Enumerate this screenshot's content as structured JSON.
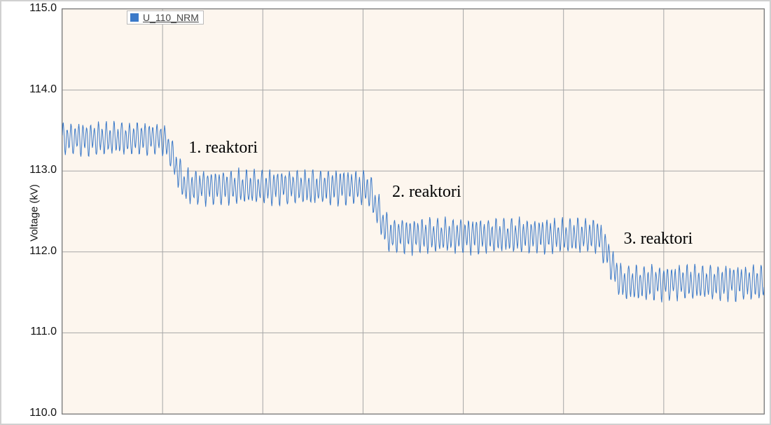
{
  "chart_data": {
    "type": "line",
    "ylabel": "Voltage (kV)",
    "xlabel": "",
    "ylim": [
      110.0,
      115.0
    ],
    "y_ticks": [
      110.0,
      111.0,
      112.0,
      113.0,
      114.0,
      115.0
    ],
    "x_grid_divisions": 7,
    "series": [
      {
        "name": "U_110_NRM",
        "color": "#3b79c8",
        "segments": [
          {
            "x_frac_start": 0.0,
            "x_frac_end": 0.16,
            "base": 113.4,
            "amplitude": 0.16,
            "freq": 180
          },
          {
            "x_frac_start": 0.16,
            "x_frac_end": 0.45,
            "base": 112.8,
            "amplitude": 0.17,
            "freq": 180
          },
          {
            "x_frac_start": 0.45,
            "x_frac_end": 0.78,
            "base": 112.2,
            "amplitude": 0.17,
            "freq": 180
          },
          {
            "x_frac_start": 0.78,
            "x_frac_end": 1.0,
            "base": 111.62,
            "amplitude": 0.17,
            "freq": 180
          }
        ]
      }
    ],
    "annotations": [
      {
        "text": "1. reaktori",
        "x_frac": 0.18,
        "y": 113.28
      },
      {
        "text": "2. reaktori",
        "x_frac": 0.47,
        "y": 112.73
      },
      {
        "text": "3. reaktori",
        "x_frac": 0.8,
        "y": 112.15
      }
    ]
  },
  "legend": {
    "label": "U_110_NRM"
  },
  "y_tick_labels": {
    "t0": "110.0",
    "t1": "111.0",
    "t2": "112.0",
    "t3": "113.0",
    "t4": "114.0",
    "t5": "115.0"
  },
  "axis": {
    "ylabel": "Voltage (kV)"
  },
  "ann": {
    "a0": "1. reaktori",
    "a1": "2. reaktori",
    "a2": "3. reaktori"
  }
}
